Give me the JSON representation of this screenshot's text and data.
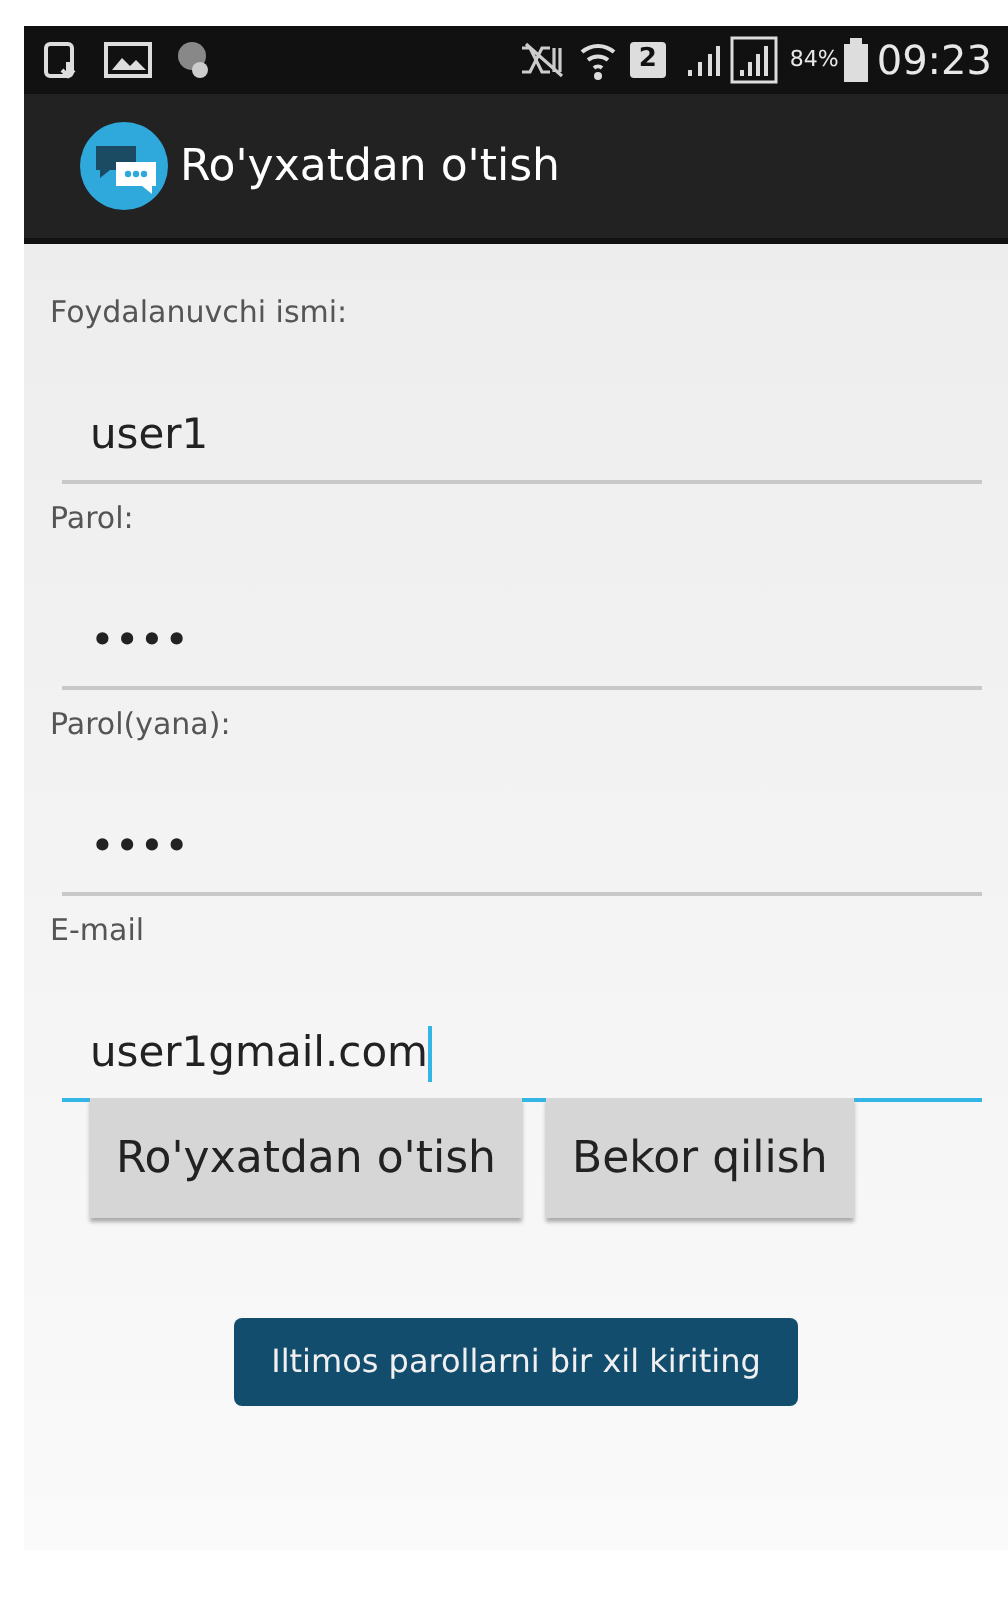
{
  "status_bar": {
    "battery_text": "84%",
    "sim_slot": "2",
    "time": "09:23"
  },
  "app_bar": {
    "title": "Ro'yxatdan o'tish"
  },
  "fields": [
    {
      "label": "Foydalanuvchi ismi:",
      "value": "user1",
      "focused": false
    },
    {
      "label": "Parol:",
      "value": "••••",
      "focused": false
    },
    {
      "label": "Parol(yana):",
      "value": "••••",
      "focused": false
    },
    {
      "label": "E-mail",
      "value": "user1gmail.com",
      "focused": true
    }
  ],
  "buttons": [
    "Ro'yxatdan o'tish",
    "Bekor qilish"
  ],
  "toast": "Iltimos parollarni bir xil kiriting"
}
